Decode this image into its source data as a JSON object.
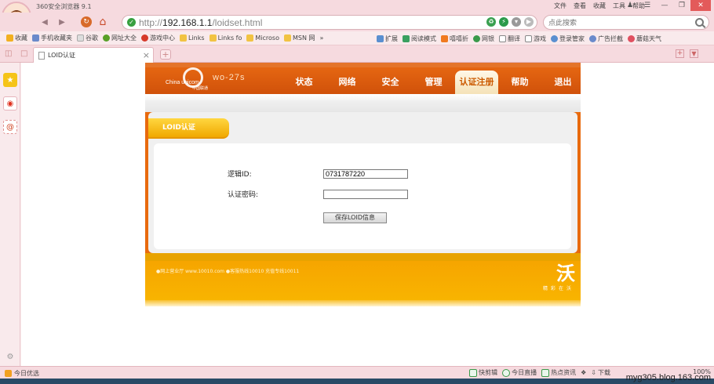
{
  "app": {
    "title": "360安全浏览器 9.1"
  },
  "topmenu": [
    "文件",
    "查看",
    "收藏",
    "工具",
    "帮助"
  ],
  "address": {
    "scheme": "http://",
    "host": "192.168.1.1",
    "path": "/loidset.html"
  },
  "search": {
    "placeholder": "点此搜索"
  },
  "bookmarks_left": [
    "收藏",
    "手机收藏夹",
    "谷歌",
    "网址大全",
    "游戏中心",
    "Links",
    "Links fo",
    "Microso",
    "MSN 网",
    "»"
  ],
  "bookmarks_right": [
    "扩展",
    "阅读模式",
    "嘻嘻折",
    "网银",
    "翻译",
    "游戏",
    "登录管家",
    "广告拦截",
    "蘑菇天气"
  ],
  "tab": {
    "title": "LOID认证"
  },
  "router": {
    "brand_cn": "中国联通",
    "brand_en": "China unicom",
    "model": "wo-27s",
    "nav": [
      "状态",
      "网络",
      "安全",
      "管理",
      "认证注册",
      "帮助",
      "退出"
    ],
    "active_nav": "认证注册",
    "section_title": "LOID认证",
    "form": {
      "loid_label": "逻辑ID:",
      "loid_value": "0731787220",
      "password_label": "认证密码:",
      "password_value": "",
      "save_label": "保存LOID信息"
    },
    "footer_text": "●网上营业厅 www.10010.com ●客服热线10010  充值专线10011",
    "footer_logo": "沃",
    "footer_slogan": "精彩在沃"
  },
  "statusbar": {
    "left": "今日优选",
    "items": [
      "快剪辑",
      "今日直播",
      "热点资讯",
      "下载",
      "100%"
    ]
  },
  "watermark": "myg305.blog.163.com"
}
